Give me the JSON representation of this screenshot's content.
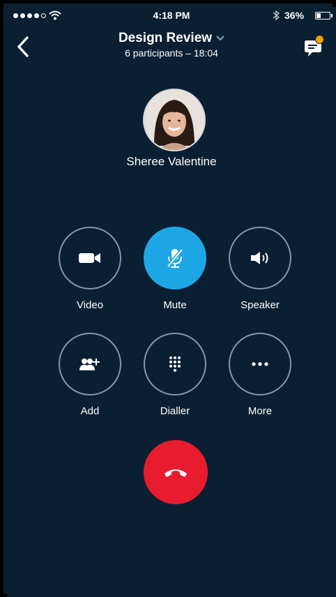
{
  "status_bar": {
    "time": "4:18 PM",
    "battery_percent": "36%",
    "battery_level": 0.36,
    "signal_dots": 5,
    "signal_filled": 4,
    "icons": [
      "wifi-icon",
      "bluetooth-icon",
      "battery-icon"
    ]
  },
  "header": {
    "title": "Design Review",
    "subtitle": "6 participants – 18:04",
    "icons": [
      "back-chevron-icon",
      "dropdown-chevron-icon",
      "chat-icon"
    ],
    "notification_color": "#f5a000"
  },
  "caller": {
    "name": "Sheree Valentine"
  },
  "controls": [
    {
      "id": "video",
      "label": "Video",
      "icon": "video-camera-icon",
      "active": false
    },
    {
      "id": "mute",
      "label": "Mute",
      "icon": "microphone-muted-icon",
      "active": true
    },
    {
      "id": "speaker",
      "label": "Speaker",
      "icon": "speaker-icon",
      "active": false
    },
    {
      "id": "add",
      "label": "Add",
      "icon": "add-people-icon",
      "active": false
    },
    {
      "id": "dialler",
      "label": "Dialler",
      "icon": "keypad-icon",
      "active": false
    },
    {
      "id": "more",
      "label": "More",
      "icon": "more-dots-icon",
      "active": false
    }
  ],
  "end_call": {
    "icon": "hang-up-icon",
    "color": "#e81c2e"
  },
  "colors": {
    "background": "#0b1f33",
    "accent": "#1ea7e6",
    "ring": "#8796a6"
  }
}
